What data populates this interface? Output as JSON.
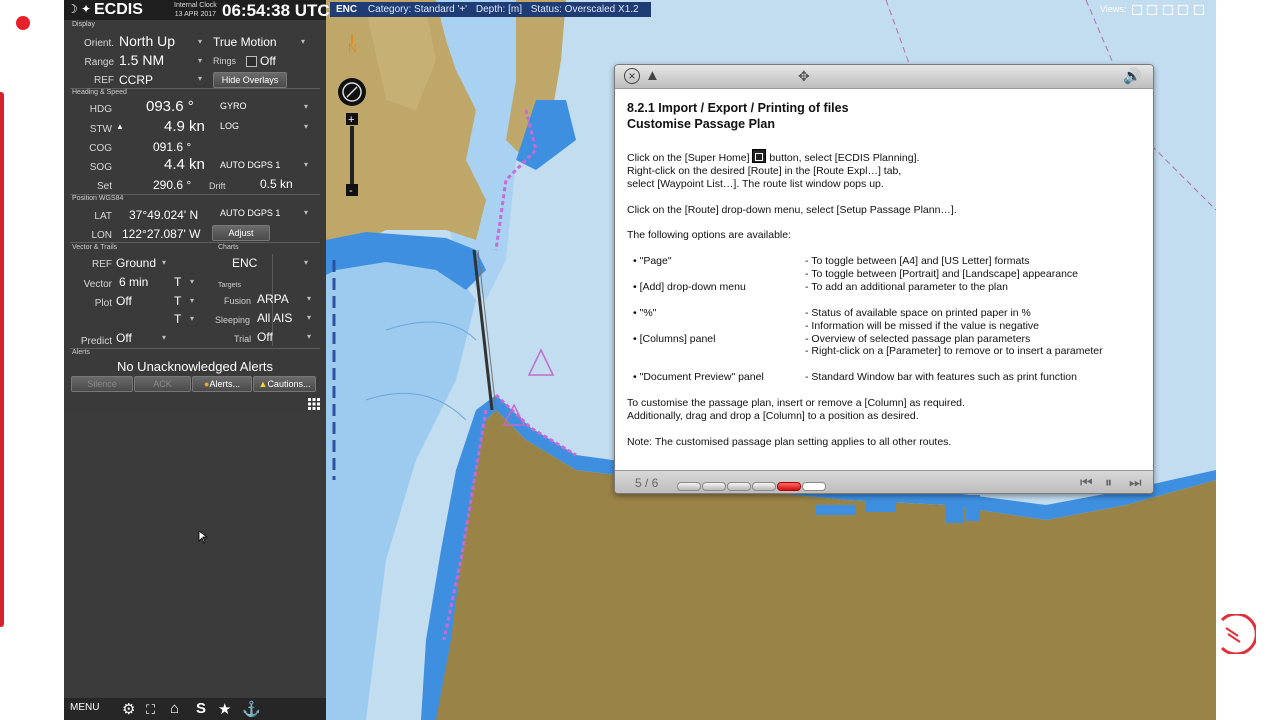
{
  "recorder": {
    "label": "Rec"
  },
  "titlebar": {
    "app": "ECDIS",
    "clock_label_1": "Internal Clock",
    "clock_label_2": "13 APR 2017",
    "time": "06:54:38 UTC"
  },
  "display": {
    "section": "Display",
    "orient_label": "Orient.",
    "orient_value": "North Up",
    "motion_value": "True Motion",
    "range_label": "Range",
    "range_value": "1.5 NM",
    "rings_label": "Rings",
    "rings_value": "Off",
    "ref_label": "REF",
    "ref_value": "CCRP",
    "hide_overlays": "Hide Overlays"
  },
  "heading": {
    "section": "Heading & Speed",
    "hdg_label": "HDG",
    "hdg_value": "093.6 °",
    "hdg_source": "GYRO",
    "stw_label": "STW",
    "stw_value": "4.9 kn",
    "stw_source": "LOG",
    "cog_label": "COG",
    "cog_value": "091.6 °",
    "sog_label": "SOG",
    "sog_value": "4.4 kn",
    "sog_source": "AUTO DGPS 1",
    "set_label": "Set",
    "set_value": "290.6 °",
    "drift_label": "Drift",
    "drift_value": "0.5 kn"
  },
  "position": {
    "section": "Position WGS84",
    "lat_label": "LAT",
    "lat_value": "37°49.024' N",
    "lat_source": "AUTO DGPS 1",
    "lon_label": "LON",
    "lon_value": "122°27.087' W",
    "adjust": "Adjust"
  },
  "vector": {
    "section": "Vector & Trails",
    "ref_label": "REF",
    "ref_value": "Ground",
    "vector_label": "Vector",
    "vector_value": "6 min",
    "t1": "T",
    "plot_label": "Plot",
    "plot_value": "Off",
    "t2": "T",
    "t3": "T",
    "predict_label": "Predict",
    "predict_value": "Off"
  },
  "charts": {
    "section": "Charts",
    "value": "ENC"
  },
  "targets": {
    "section": "Targets",
    "fusion_label": "Fusion",
    "fusion_value": "ARPA",
    "sleeping_label": "Sleeping",
    "sleeping_value": "All AIS",
    "trial_label": "Trial",
    "trial_value": "Off"
  },
  "alerts": {
    "section": "Alerts",
    "message": "No Unacknowledged Alerts",
    "silence": "Silence",
    "ack": "ACK",
    "alerts_btn": "Alerts...",
    "cautions_btn": "Cautions..."
  },
  "bottombar": {
    "menu": "MENU"
  },
  "chart": {
    "tab": "ENC",
    "category": "Category: Standard '+'",
    "depth": "Depth: [m]",
    "status": "Status: Overscaled X1.2",
    "views_label": "Views:"
  },
  "dialog": {
    "title_1": "8.2.1 Import / Export / Printing of files",
    "title_2": "Customise Passage Plan",
    "p1_a": "Click on the [Super Home]",
    "p1_b": "button, select [ECDIS Planning].",
    "p1_c": "Right-click on the desired [Route] in the [Route Expl…] tab,",
    "p1_d": "select [Waypoint List…]. The route list window pops up.",
    "p2": "Click on the [Route] drop-down menu, select [Setup Passage Plann…].",
    "p3": "The following options are available:",
    "options": [
      {
        "k": "• \"Page\"",
        "v": "- To toggle between [A4] and [US Letter] formats"
      },
      {
        "k": "",
        "v": "- To toggle between [Portrait] and [Landscape] appearance"
      },
      {
        "k": "• [Add] drop-down menu",
        "v": "- To add an additional parameter to the plan"
      },
      {
        "k": "",
        "v": ""
      },
      {
        "k": "• \"%\"",
        "v": "- Status of available space on printed paper in %"
      },
      {
        "k": "",
        "v": "- Information will be missed if the value is negative"
      },
      {
        "k": "• [Columns] panel",
        "v": "- Overview of selected passage plan parameters"
      },
      {
        "k": "",
        "v": "- Right-click on a [Parameter] to remove or to insert a parameter"
      },
      {
        "k": "",
        "v": ""
      },
      {
        "k": "• \"Document Preview\" panel",
        "v": "- Standard Window bar with features such as print function"
      }
    ],
    "p4_a": "To customise the passage plan, insert or remove a [Column] as required.",
    "p4_b": "Additionally, drag and drop a [Column] to a position as desired.",
    "p5": "Note: The customised passage plan setting applies to all other routes.",
    "pager": "5 / 6",
    "slides_total": 6,
    "slide_current": 5
  }
}
